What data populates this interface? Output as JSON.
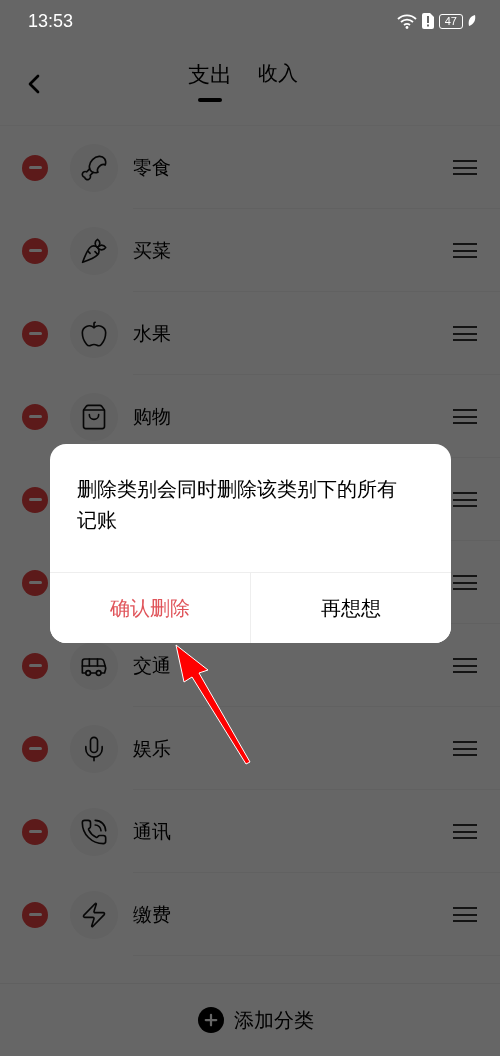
{
  "status_bar": {
    "time": "13:53",
    "battery": "47"
  },
  "tabs": [
    {
      "label": "支出",
      "selected": true
    },
    {
      "label": "收入",
      "selected": false
    }
  ],
  "rows": [
    {
      "kind": "category",
      "label": "零食"
    },
    {
      "kind": "category",
      "label": "买菜"
    },
    {
      "kind": "category",
      "label": "水果"
    },
    {
      "kind": "category",
      "label": "购物"
    },
    {
      "kind": "covered"
    },
    {
      "kind": "covered"
    },
    {
      "kind": "category",
      "label": "交通"
    },
    {
      "kind": "category",
      "label": "娱乐"
    },
    {
      "kind": "category",
      "label": "通讯"
    },
    {
      "kind": "category",
      "label": "缴费"
    }
  ],
  "add_button": {
    "label": "添加分类"
  },
  "dialog": {
    "message": "删除类别会同时删除该类别下的所有记账",
    "buttons": [
      {
        "label": "确认删除",
        "kind": "danger"
      },
      {
        "label": "再想想",
        "kind": "normal"
      }
    ]
  }
}
